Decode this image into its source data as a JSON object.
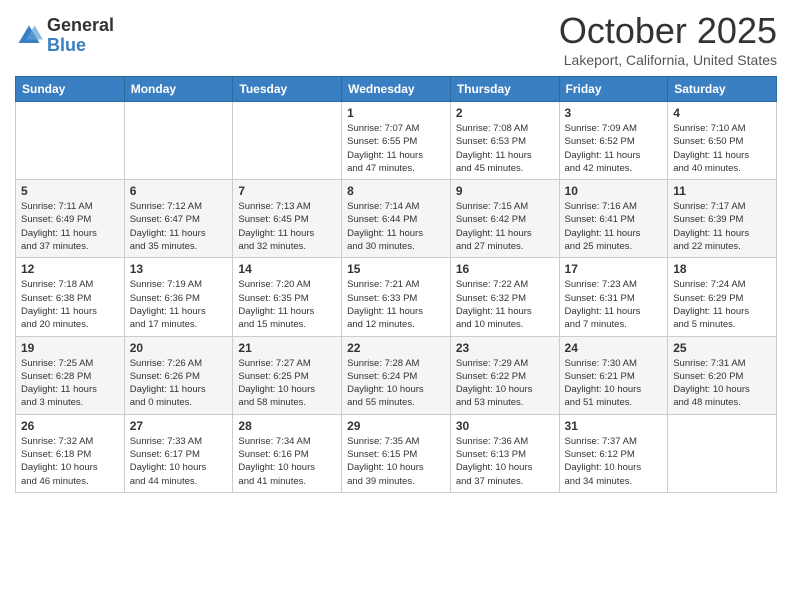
{
  "header": {
    "logo_general": "General",
    "logo_blue": "Blue",
    "month": "October 2025",
    "location": "Lakeport, California, United States"
  },
  "days_of_week": [
    "Sunday",
    "Monday",
    "Tuesday",
    "Wednesday",
    "Thursday",
    "Friday",
    "Saturday"
  ],
  "weeks": [
    [
      {
        "day": "",
        "info": ""
      },
      {
        "day": "",
        "info": ""
      },
      {
        "day": "",
        "info": ""
      },
      {
        "day": "1",
        "info": "Sunrise: 7:07 AM\nSunset: 6:55 PM\nDaylight: 11 hours\nand 47 minutes."
      },
      {
        "day": "2",
        "info": "Sunrise: 7:08 AM\nSunset: 6:53 PM\nDaylight: 11 hours\nand 45 minutes."
      },
      {
        "day": "3",
        "info": "Sunrise: 7:09 AM\nSunset: 6:52 PM\nDaylight: 11 hours\nand 42 minutes."
      },
      {
        "day": "4",
        "info": "Sunrise: 7:10 AM\nSunset: 6:50 PM\nDaylight: 11 hours\nand 40 minutes."
      }
    ],
    [
      {
        "day": "5",
        "info": "Sunrise: 7:11 AM\nSunset: 6:49 PM\nDaylight: 11 hours\nand 37 minutes."
      },
      {
        "day": "6",
        "info": "Sunrise: 7:12 AM\nSunset: 6:47 PM\nDaylight: 11 hours\nand 35 minutes."
      },
      {
        "day": "7",
        "info": "Sunrise: 7:13 AM\nSunset: 6:45 PM\nDaylight: 11 hours\nand 32 minutes."
      },
      {
        "day": "8",
        "info": "Sunrise: 7:14 AM\nSunset: 6:44 PM\nDaylight: 11 hours\nand 30 minutes."
      },
      {
        "day": "9",
        "info": "Sunrise: 7:15 AM\nSunset: 6:42 PM\nDaylight: 11 hours\nand 27 minutes."
      },
      {
        "day": "10",
        "info": "Sunrise: 7:16 AM\nSunset: 6:41 PM\nDaylight: 11 hours\nand 25 minutes."
      },
      {
        "day": "11",
        "info": "Sunrise: 7:17 AM\nSunset: 6:39 PM\nDaylight: 11 hours\nand 22 minutes."
      }
    ],
    [
      {
        "day": "12",
        "info": "Sunrise: 7:18 AM\nSunset: 6:38 PM\nDaylight: 11 hours\nand 20 minutes."
      },
      {
        "day": "13",
        "info": "Sunrise: 7:19 AM\nSunset: 6:36 PM\nDaylight: 11 hours\nand 17 minutes."
      },
      {
        "day": "14",
        "info": "Sunrise: 7:20 AM\nSunset: 6:35 PM\nDaylight: 11 hours\nand 15 minutes."
      },
      {
        "day": "15",
        "info": "Sunrise: 7:21 AM\nSunset: 6:33 PM\nDaylight: 11 hours\nand 12 minutes."
      },
      {
        "day": "16",
        "info": "Sunrise: 7:22 AM\nSunset: 6:32 PM\nDaylight: 11 hours\nand 10 minutes."
      },
      {
        "day": "17",
        "info": "Sunrise: 7:23 AM\nSunset: 6:31 PM\nDaylight: 11 hours\nand 7 minutes."
      },
      {
        "day": "18",
        "info": "Sunrise: 7:24 AM\nSunset: 6:29 PM\nDaylight: 11 hours\nand 5 minutes."
      }
    ],
    [
      {
        "day": "19",
        "info": "Sunrise: 7:25 AM\nSunset: 6:28 PM\nDaylight: 11 hours\nand 3 minutes."
      },
      {
        "day": "20",
        "info": "Sunrise: 7:26 AM\nSunset: 6:26 PM\nDaylight: 11 hours\nand 0 minutes."
      },
      {
        "day": "21",
        "info": "Sunrise: 7:27 AM\nSunset: 6:25 PM\nDaylight: 10 hours\nand 58 minutes."
      },
      {
        "day": "22",
        "info": "Sunrise: 7:28 AM\nSunset: 6:24 PM\nDaylight: 10 hours\nand 55 minutes."
      },
      {
        "day": "23",
        "info": "Sunrise: 7:29 AM\nSunset: 6:22 PM\nDaylight: 10 hours\nand 53 minutes."
      },
      {
        "day": "24",
        "info": "Sunrise: 7:30 AM\nSunset: 6:21 PM\nDaylight: 10 hours\nand 51 minutes."
      },
      {
        "day": "25",
        "info": "Sunrise: 7:31 AM\nSunset: 6:20 PM\nDaylight: 10 hours\nand 48 minutes."
      }
    ],
    [
      {
        "day": "26",
        "info": "Sunrise: 7:32 AM\nSunset: 6:18 PM\nDaylight: 10 hours\nand 46 minutes."
      },
      {
        "day": "27",
        "info": "Sunrise: 7:33 AM\nSunset: 6:17 PM\nDaylight: 10 hours\nand 44 minutes."
      },
      {
        "day": "28",
        "info": "Sunrise: 7:34 AM\nSunset: 6:16 PM\nDaylight: 10 hours\nand 41 minutes."
      },
      {
        "day": "29",
        "info": "Sunrise: 7:35 AM\nSunset: 6:15 PM\nDaylight: 10 hours\nand 39 minutes."
      },
      {
        "day": "30",
        "info": "Sunrise: 7:36 AM\nSunset: 6:13 PM\nDaylight: 10 hours\nand 37 minutes."
      },
      {
        "day": "31",
        "info": "Sunrise: 7:37 AM\nSunset: 6:12 PM\nDaylight: 10 hours\nand 34 minutes."
      },
      {
        "day": "",
        "info": ""
      }
    ]
  ]
}
